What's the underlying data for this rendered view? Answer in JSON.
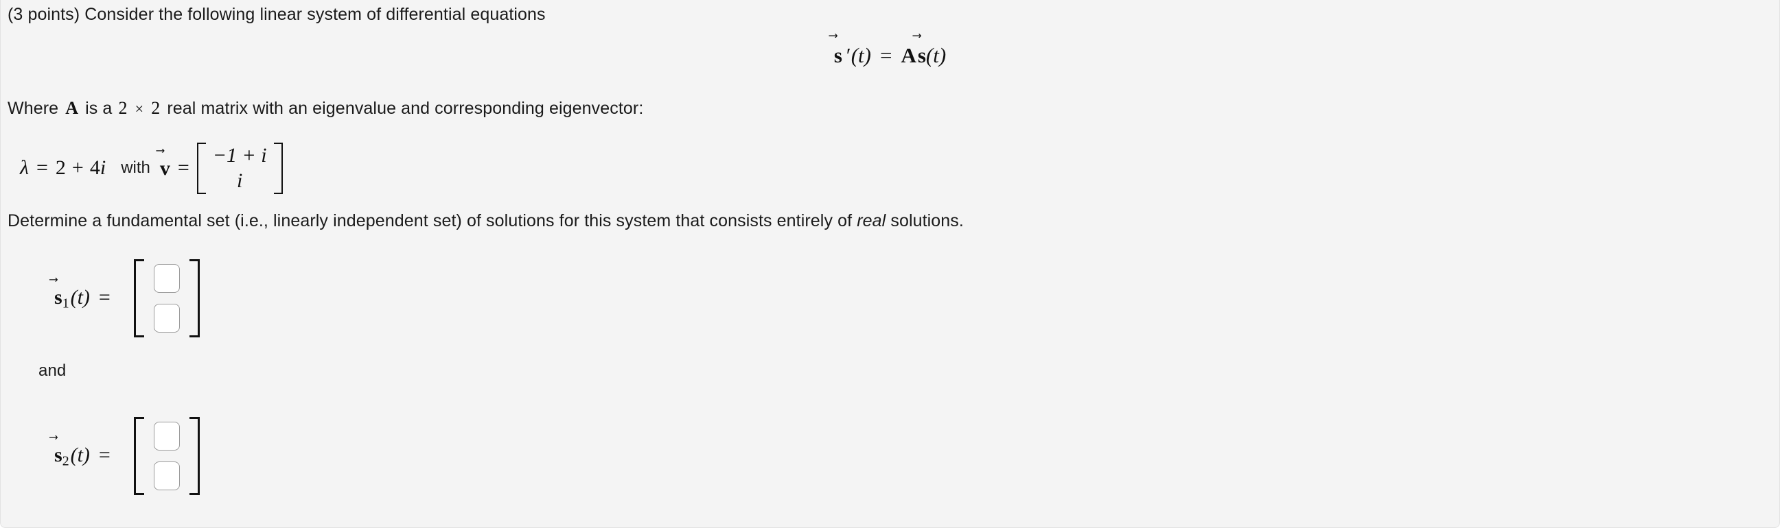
{
  "question": {
    "points_prefix": "(3 points)",
    "prompt_lead": "Consider the following linear system of differential equations",
    "display_equation": {
      "lhs_symbol": "s",
      "lhs_prime": "′",
      "lhs_arg": "(t)",
      "relation": "=",
      "rhs_matrix": "A",
      "rhs_symbol": "s",
      "rhs_arg": "(t)",
      "arrow": "⃗",
      "plain": "s⃗′(t) = A s⃗(t)"
    },
    "matrix_description": {
      "prefix": "Where",
      "matrix_name": "A",
      "middle": "is a",
      "dim_rows": "2",
      "times": "×",
      "dim_cols": "2",
      "suffix": "real matrix with an eigenvalue and corresponding eigenvector:",
      "plain": "Where A is a 2 × 2 real matrix with an eigenvalue and corresponding eigenvector:"
    },
    "eigen": {
      "lambda_symbol": "λ",
      "equals": "=",
      "eigenvalue": "2 + 4i",
      "eigenvalue_real_part": "2",
      "eigenvalue_plus": "+",
      "eigenvalue_imag_part": "4",
      "imaginary_unit": "i",
      "conjunction": "with",
      "eigenvector_symbol": "v",
      "arrow": "⃗",
      "eigenvector_entries": [
        "−1 + i",
        "i"
      ],
      "plain": "λ = 2 + 4i  with  v⃗ = [−1 + i ; i]"
    },
    "instruction": {
      "before_italic": "Determine a fundamental set (i.e., linearly independent set) of solutions for this system that consists entirely of ",
      "italic_word": "real",
      "after_italic": " solutions.",
      "plain": "Determine a fundamental set (i.e., linearly independent set) of solutions for this system that consists entirely of real solutions."
    }
  },
  "answers": {
    "connector": "and",
    "solution_1": {
      "symbol": "s",
      "arrow": "⃗",
      "subscript": "1",
      "argument": "(t)",
      "equals": "=",
      "label_plain": "s⃗₁(t) =",
      "fields": [
        {
          "name": "solution-1-row-1",
          "value": "",
          "placeholder": ""
        },
        {
          "name": "solution-1-row-2",
          "value": "",
          "placeholder": ""
        }
      ]
    },
    "solution_2": {
      "symbol": "s",
      "arrow": "⃗",
      "subscript": "2",
      "argument": "(t)",
      "equals": "=",
      "label_plain": "s⃗₂(t) =",
      "fields": [
        {
          "name": "solution-2-row-1",
          "value": "",
          "placeholder": ""
        },
        {
          "name": "solution-2-row-2",
          "value": "",
          "placeholder": ""
        }
      ]
    }
  },
  "theme": {
    "page_background": "#f4f4f4",
    "card_border": "#e2e2e2",
    "text_color": "#1a1a1a",
    "math_color": "#111111",
    "input_background": "#ffffff",
    "input_border": "#9a9a9a"
  }
}
